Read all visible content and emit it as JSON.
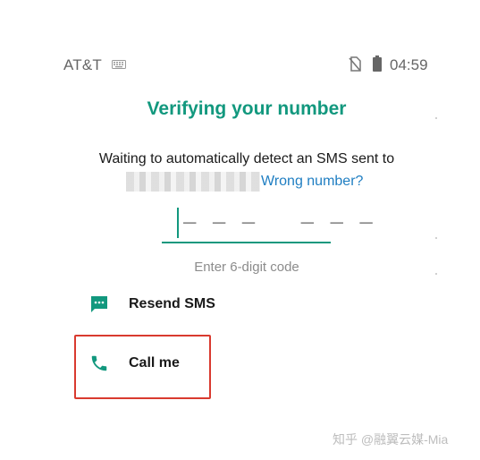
{
  "status_bar": {
    "carrier": "AT&T",
    "time": "04:59",
    "keyboard_icon": "keyboard-icon",
    "sim_icon": "no-sim-icon",
    "battery_icon": "battery-icon"
  },
  "screen": {
    "title": "Verifying your number",
    "instruction": "Waiting to automatically detect an SMS sent to",
    "wrong_number_link": "Wrong number?",
    "code_placeholder": "– – –   – – –",
    "code_hint": "Enter 6-digit code"
  },
  "options": [
    {
      "label": "Resend SMS",
      "icon": "message-icon"
    },
    {
      "label": "Call me",
      "icon": "phone-icon"
    }
  ],
  "watermark": "知乎 @融翼云媒-Mia",
  "colors": {
    "accent": "#12987e",
    "link": "#1f7ec2",
    "highlight": "#d93a2f"
  }
}
